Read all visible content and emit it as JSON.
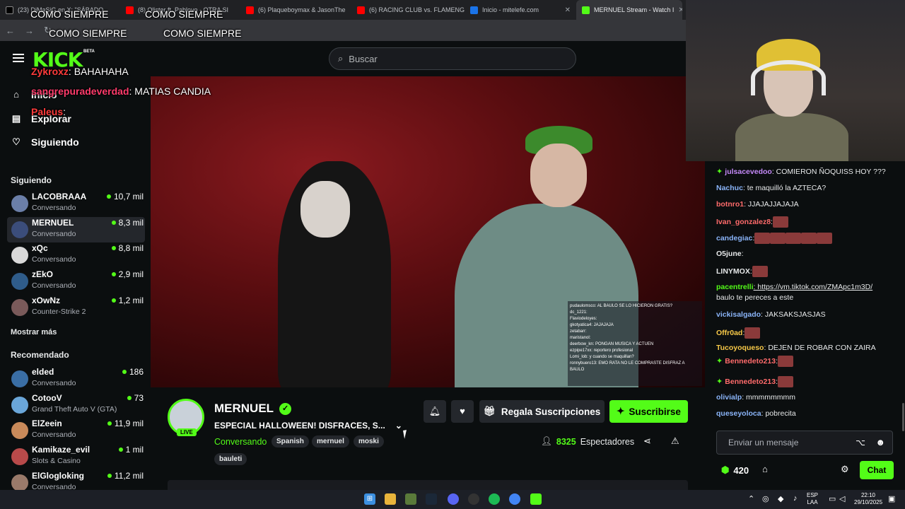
{
  "browser": {
    "tabs": [
      {
        "label": "(23) DiMaSiG en X: \"SÁBADO",
        "color": "#000000"
      },
      {
        "label": "(8) Olister ft. Pablovo - OTRA SI",
        "color": "#ff0000"
      },
      {
        "label": "(6) Plaqueboymax & JasonThe",
        "color": "#ff0000"
      },
      {
        "label": "(6) RACING CLUB vs. FLAMENG",
        "color": "#ff0000"
      },
      {
        "label": "Inicio - mitelefe.com",
        "color": "#1a73e8"
      },
      {
        "label": "MERNUEL Stream - Watch I",
        "color": "#53fc18"
      }
    ]
  },
  "overlay": {
    "como1": "COMO SIEMPRE",
    "como2": "COMO SIEMPRE",
    "como3": "COMO SIEMPRE",
    "como4": "COMO SIEMPRE",
    "m1_user": "Zykroxz",
    "m1_text": ": BAHAHAHA",
    "m2_user": "sangrepuradeverdad",
    "m2_text": ": MATIAS CANDIA",
    "m3_user": "Paleus",
    "m3_text": ":"
  },
  "header": {
    "logo": "KICK",
    "beta": "BETA",
    "search_placeholder": "Buscar"
  },
  "sidebar": {
    "nav": [
      {
        "label": "Inicio",
        "icon": "home-icon"
      },
      {
        "label": "Explorar",
        "icon": "browse-icon"
      },
      {
        "label": "Siguiendo",
        "icon": "heart-icon"
      }
    ],
    "following_title": "Siguiendo",
    "following": [
      {
        "name": "LACOBRAAA",
        "category": "Conversando",
        "viewers": "10,7 mil",
        "color": "#6b7fa8"
      },
      {
        "name": "MERNUEL",
        "category": "Conversando",
        "viewers": "8,3 mil",
        "color": "#3b4d7a"
      },
      {
        "name": "xQc",
        "category": "Conversando",
        "viewers": "8,8 mil",
        "color": "#d9d9d9"
      },
      {
        "name": "zEkO",
        "category": "Conversando",
        "viewers": "2,9 mil",
        "color": "#2f5c8a"
      },
      {
        "name": "xOwNz",
        "category": "Counter-Strike 2",
        "viewers": "1,2 mil",
        "color": "#7a5a5a"
      }
    ],
    "show_more": "Mostrar más",
    "recommended_title": "Recomendado",
    "recommended": [
      {
        "name": "elded",
        "category": "Conversando",
        "viewers": "186",
        "color": "#3a6ea5"
      },
      {
        "name": "CotooV",
        "category": "Grand Theft Auto V (GTA)",
        "viewers": "73",
        "color": "#6aa6d9"
      },
      {
        "name": "ElZeein",
        "category": "Conversando",
        "viewers": "11,9 mil",
        "color": "#c98a5a"
      },
      {
        "name": "Kamikaze_evil",
        "category": "Slots & Casino",
        "viewers": "1 mil",
        "color": "#b84a4a"
      },
      {
        "name": "ElGlogloking",
        "category": "Conversando",
        "viewers": "11,2 mil",
        "color": "#9a7a6a"
      }
    ]
  },
  "video": {
    "mini_chat": [
      "pudaulomsco: AL BAULO SE LO HICIERON GRATIS?",
      "dc_1221:",
      "Flaviodeloyes:",
      "gkotyatica4: JAJAJAJA",
      "zetabarr:",
      "maristanol:",
      "deerbow_kn: PONGAN MUSICA Y ACTUEN",
      "ezpipe17xx: reportero profesional",
      "Lomi_lob: y cuando se maquillan?",
      "ronnybuero13: EMO RATA NO LE COMPRASTE DISFRAZ A BAULO"
    ]
  },
  "channel": {
    "name": "MERNUEL",
    "live": "LIVE",
    "title": "ESPECIAL HALLOWEEN! DISFRACES, S...",
    "category": "Conversando",
    "tags": [
      "Spanish",
      "mernuel",
      "moski",
      "bauleti"
    ],
    "gift_label": "Regala Suscripciones",
    "subscribe_label": "Suscribirse",
    "viewers_count": "8325",
    "viewers_label": "Espectadores",
    "accent": "#53fc18"
  },
  "chat": {
    "messages": [
      {
        "user": "julsacevedoo",
        "color": "#c58af9",
        "text": ": COMIERON ÑOQUISS HOY ???",
        "badge": true
      },
      {
        "user": "Nachuc",
        "color": "#8ab4f8",
        "text": ": te maquilló la AZTECA?",
        "badge": false
      },
      {
        "user": "botnro1",
        "color": "#ff6b6b",
        "text": ": JJAJAJJAJAJA",
        "badge": false
      },
      {
        "user": "Ivan_gonzalez8",
        "color": "#ff6b6b",
        "text": ":",
        "badge": false,
        "emotes": 1
      },
      {
        "user": "candegiac",
        "color": "#8ab4f8",
        "text": ":",
        "badge": false,
        "emotes": 5
      },
      {
        "user": "O5june",
        "color": "#e7e9ea",
        "text": ":",
        "badge": false,
        "emotes": 0
      },
      {
        "user": "LINYMOX",
        "color": "#e7e9ea",
        "text": ":",
        "badge": false,
        "emotes": 1
      },
      {
        "user": "pacentrelli",
        "color": "#53fc18",
        "text": ": https://vm.tiktok.com/ZMApc1m3D/",
        "badge": false
      },
      {
        "user": "",
        "color": "#e7e9ea",
        "text": "baulo te pereces a este",
        "badge": false
      },
      {
        "user": "vickisalgado",
        "color": "#8ab4f8",
        "text": ": JAKSAKSJASJAS",
        "badge": false
      },
      {
        "user": "Offr0ad",
        "color": "#f7c948",
        "text": ":",
        "badge": false,
        "emotes": 1
      },
      {
        "user": "Tucoyoqueso",
        "color": "#f7c948",
        "text": ": DEJEN DE ROBAR CON ZAIRA",
        "badge": false
      },
      {
        "user": "Bennedeto213",
        "color": "#ff6b6b",
        "text": ":",
        "badge": true,
        "emotes": 1
      },
      {
        "user": "Bennedeto213",
        "color": "#ff6b6b",
        "text": ":",
        "badge": true,
        "emotes": 1
      },
      {
        "user": "olivialp",
        "color": "#8ab4f8",
        "text": ": mmmmmmmm",
        "badge": false
      },
      {
        "user": "queseyoloca",
        "color": "#8ab4f8",
        "text": ": pobrecita",
        "badge": false
      }
    ],
    "input_placeholder": "Enviar un mensaje",
    "points": "420",
    "chat_button": "Chat"
  },
  "taskbar": {
    "lang1": "ESP",
    "lang2": "LAA",
    "time": "22:10",
    "date": "29/10/2025"
  }
}
